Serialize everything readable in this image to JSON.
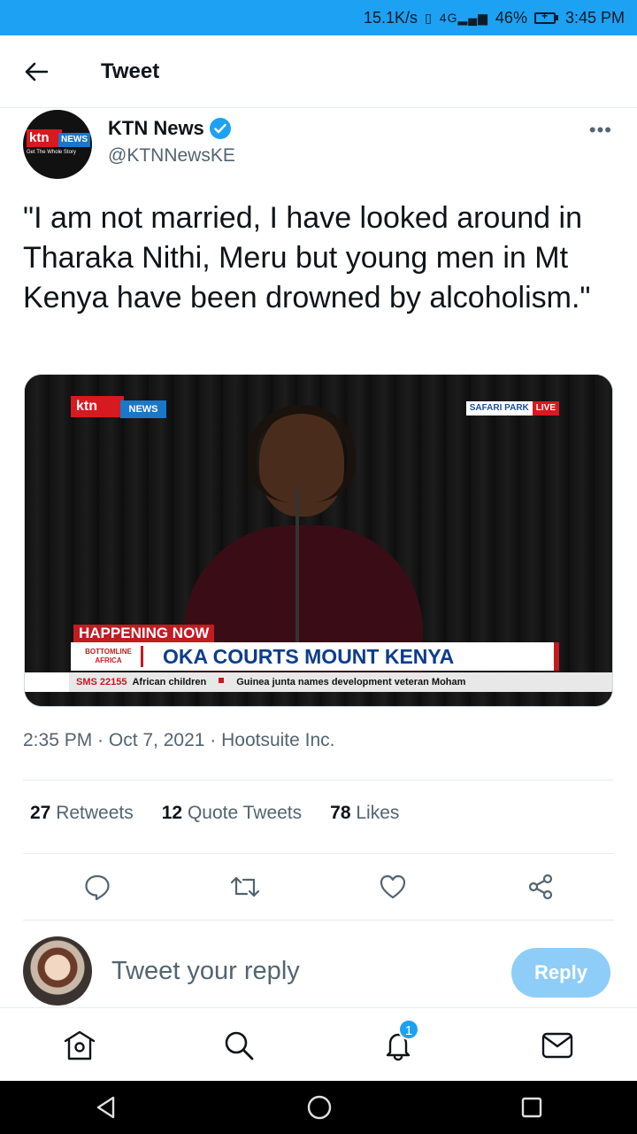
{
  "status_bar": {
    "net_speed": "15.1K/s",
    "network": "4G",
    "battery": "46%",
    "time": "3:45 PM"
  },
  "header": {
    "title": "Tweet"
  },
  "tweet": {
    "author_name": "KTN News",
    "author_handle": "@KTNNewsKE",
    "avatar_logo": {
      "ktn": "ktn",
      "news": "NEWS",
      "tagline": "Get The Whole Story"
    },
    "text": "\"I am not married, I have looked around in Tharaka Nithi, Meru but young men in Mt Kenya have been drowned by alcoholism.\"",
    "media": {
      "logo_ktn": "ktn",
      "logo_news": "NEWS",
      "location": "SAFARI PARK",
      "live": "LIVE",
      "happening": "HAPPENING NOW",
      "program": "BOTTOMLINE AFRICA",
      "headline": "OKA COURTS MOUNT KENYA",
      "ticker_sms": "SMS 22155",
      "ticker_1": "African children",
      "ticker_2": "Guinea junta names development veteran Moham"
    },
    "timestamp": "2:35 PM · Oct 7, 2021 · Hootsuite Inc.",
    "stats": {
      "retweets_count": "27",
      "retweets_label": "Retweets",
      "quotes_count": "12",
      "quotes_label": "Quote Tweets",
      "likes_count": "78",
      "likes_label": "Likes"
    }
  },
  "reply": {
    "placeholder": "Tweet your reply",
    "button_label": "Reply"
  },
  "bottom_nav": {
    "notification_badge": "1"
  },
  "colors": {
    "accent": "#1da1f2",
    "reply_button": "#8ecdf8",
    "secondary_text": "#536471"
  }
}
